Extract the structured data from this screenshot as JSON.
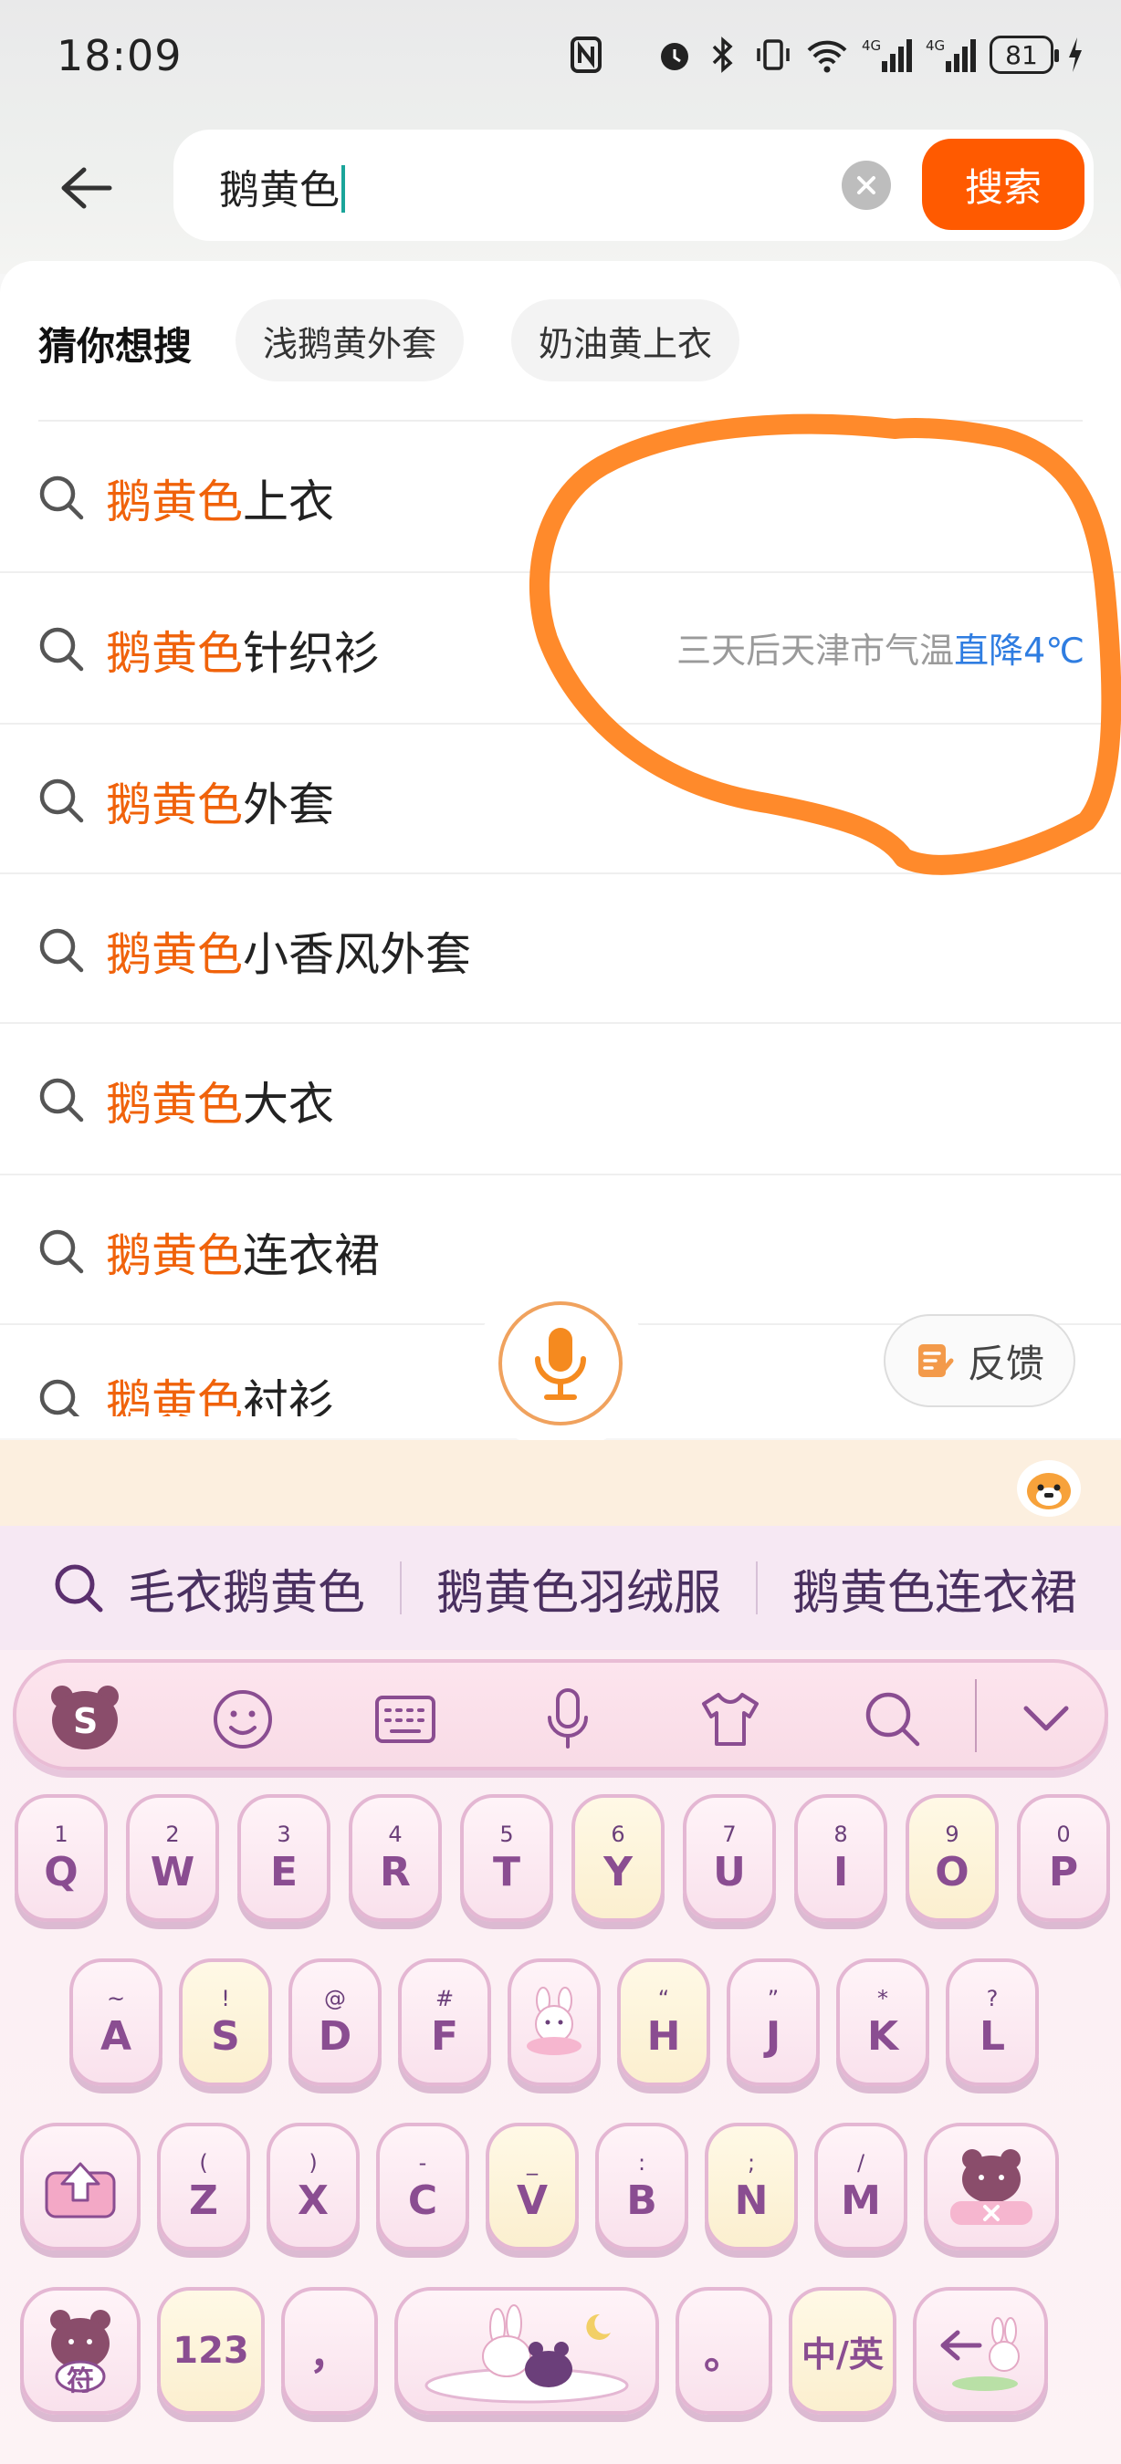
{
  "status_bar": {
    "time": "18:09",
    "battery": "81"
  },
  "search": {
    "query": "鹅黄色",
    "button_label": "搜索"
  },
  "guess": {
    "title": "猜你想搜",
    "chips": [
      "浅鹅黄外套",
      "奶油黄上衣"
    ]
  },
  "suggestions": [
    {
      "highlight": "鹅黄色",
      "rest": "上衣"
    },
    {
      "highlight": "鹅黄色",
      "rest": "针织衫"
    },
    {
      "highlight": "鹅黄色",
      "rest": "外套"
    },
    {
      "highlight": "鹅黄色",
      "rest": "小香风外套"
    },
    {
      "highlight": "鹅黄色",
      "rest": "大衣"
    },
    {
      "highlight": "鹅黄色",
      "rest": "连衣裙"
    },
    {
      "highlight": "鹅黄色",
      "rest": "衬衫"
    }
  ],
  "weather": {
    "text": "三天后天津市气温",
    "highlight": "直降4℃"
  },
  "feedback_label": "反馈",
  "keyboard_suggestions": [
    "毛衣鹅黄色",
    "鹅黄色羽绒服",
    "鹅黄色连衣裙"
  ],
  "keys": {
    "row1": [
      {
        "n": "1",
        "l": "Q"
      },
      {
        "n": "2",
        "l": "W"
      },
      {
        "n": "3",
        "l": "E"
      },
      {
        "n": "4",
        "l": "R"
      },
      {
        "n": "5",
        "l": "T"
      },
      {
        "n": "6",
        "l": "Y"
      },
      {
        "n": "7",
        "l": "U"
      },
      {
        "n": "8",
        "l": "I"
      },
      {
        "n": "9",
        "l": "O"
      },
      {
        "n": "0",
        "l": "P"
      }
    ],
    "row2": [
      {
        "n": "~",
        "l": "A"
      },
      {
        "n": "!",
        "l": "S"
      },
      {
        "n": "@",
        "l": "D"
      },
      {
        "n": "#",
        "l": "F"
      },
      {
        "n": "",
        "l": ""
      },
      {
        "n": "“",
        "l": "H"
      },
      {
        "n": "”",
        "l": "J"
      },
      {
        "n": "*",
        "l": "K"
      },
      {
        "n": "?",
        "l": "L"
      }
    ],
    "row3": [
      {
        "n": "(",
        "l": "Z"
      },
      {
        "n": ")",
        "l": "X"
      },
      {
        "n": "-",
        "l": "C"
      },
      {
        "n": "_",
        "l": "V"
      },
      {
        "n": ":",
        "l": "B"
      },
      {
        "n": ";",
        "l": "N"
      },
      {
        "n": "/",
        "l": "M"
      }
    ],
    "num_key": "123",
    "comma_key": "，",
    "period_key": "。",
    "lang_key": "中/英",
    "sym_key": "符"
  },
  "colors": {
    "accent": "#ff5a00",
    "highlight": "#f0620a",
    "annotation": "#ff8a2b",
    "weather_blue": "#2f7de1"
  }
}
